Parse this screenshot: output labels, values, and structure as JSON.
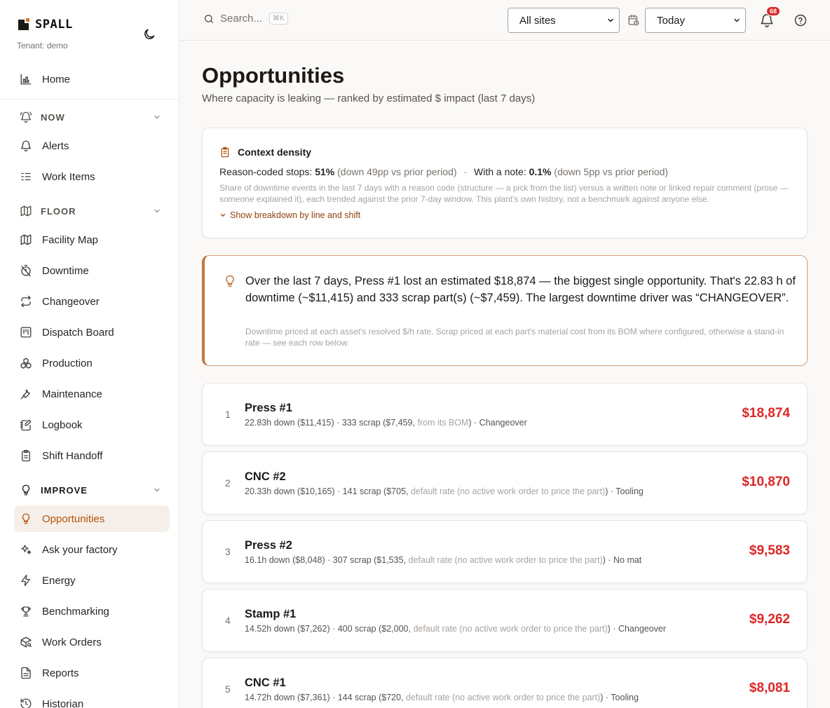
{
  "brand": {
    "wordmark": "SPALL",
    "tenant": "Tenant: demo"
  },
  "sidebar": {
    "home": "Home",
    "sections": {
      "now": {
        "label": "NOW",
        "items": [
          "Alerts",
          "Work Items"
        ]
      },
      "floor": {
        "label": "FLOOR",
        "items": [
          "Facility Map",
          "Downtime",
          "Changeover",
          "Dispatch Board",
          "Production",
          "Maintenance",
          "Logbook",
          "Shift Handoff"
        ]
      },
      "improve": {
        "label": "IMPROVE",
        "items": [
          "Opportunities",
          "Ask your factory",
          "Energy",
          "Benchmarking",
          "Work Orders",
          "Reports",
          "Historian"
        ]
      }
    },
    "active_item": "Opportunities"
  },
  "topbar": {
    "search_placeholder": "Search...",
    "search_shortcut": "⌘K",
    "site_select": "All sites",
    "range_select": "Today",
    "notification_count": "68"
  },
  "page": {
    "title": "Opportunities",
    "subtitle": "Where capacity is leaking — ranked by estimated $ impact (last 7 days)"
  },
  "context_density": {
    "title": "Context density",
    "reason_label": "Reason-coded stops:",
    "reason_value": "51%",
    "reason_delta": "(down 49pp vs prior period)",
    "separator": "·",
    "note_label": "With a note:",
    "note_value": "0.1%",
    "note_delta": "(down 5pp vs prior period)",
    "description": "Share of downtime events in the last 7 days with a reason code (structure — a pick from the list) versus a written note or linked repair comment (prose — someone explained it), each trended against the prior 7-day window. This plant's own history, not a benchmark against anyone else.",
    "toggle": "Show breakdown by line and shift"
  },
  "insight": {
    "text": "Over the last 7 days, Press #1 lost an estimated $18,874 — the biggest single opportunity. That's 22.83 h of downtime (~$11,415) and 333 scrap part(s) (~$7,459). The largest downtime driver was “CHANGEOVER”.",
    "note": "Downtime priced at each asset's resolved $/h rate. Scrap priced at each part's material cost from its BOM where configured, otherwise a stand-in rate — see each row below."
  },
  "opportunities": [
    {
      "rank": "1",
      "name": "Press #1",
      "detail_a": "22.83h down ($11,415) · 333 scrap ($7,459,",
      "detail_note": "from its BOM",
      "detail_b": ") · Changeover",
      "value": "$18,874"
    },
    {
      "rank": "2",
      "name": "CNC #2",
      "detail_a": "20.33h down ($10,165) · 141 scrap ($705,",
      "detail_note": "default rate (no active work order to price the part)",
      "detail_b": ") · Tooling",
      "value": "$10,870"
    },
    {
      "rank": "3",
      "name": "Press #2",
      "detail_a": "16.1h down ($8,048) · 307 scrap ($1,535,",
      "detail_note": "default rate (no active work order to price the part)",
      "detail_b": ") · No mat",
      "value": "$9,583"
    },
    {
      "rank": "4",
      "name": "Stamp #1",
      "detail_a": "14.52h down ($7,262) · 400 scrap ($2,000,",
      "detail_note": "default rate (no active work order to price the part)",
      "detail_b": ") · Changeover",
      "value": "$9,262"
    },
    {
      "rank": "5",
      "name": "CNC #1",
      "detail_a": "14.72h down ($7,361) · 144 scrap ($720,",
      "detail_note": "default rate (no active work order to price the part)",
      "detail_b": ") · Tooling",
      "value": "$8,081"
    }
  ],
  "colors": {
    "accent": "#b45309",
    "danger": "#dc2626",
    "insight_border": "#c2773f"
  }
}
